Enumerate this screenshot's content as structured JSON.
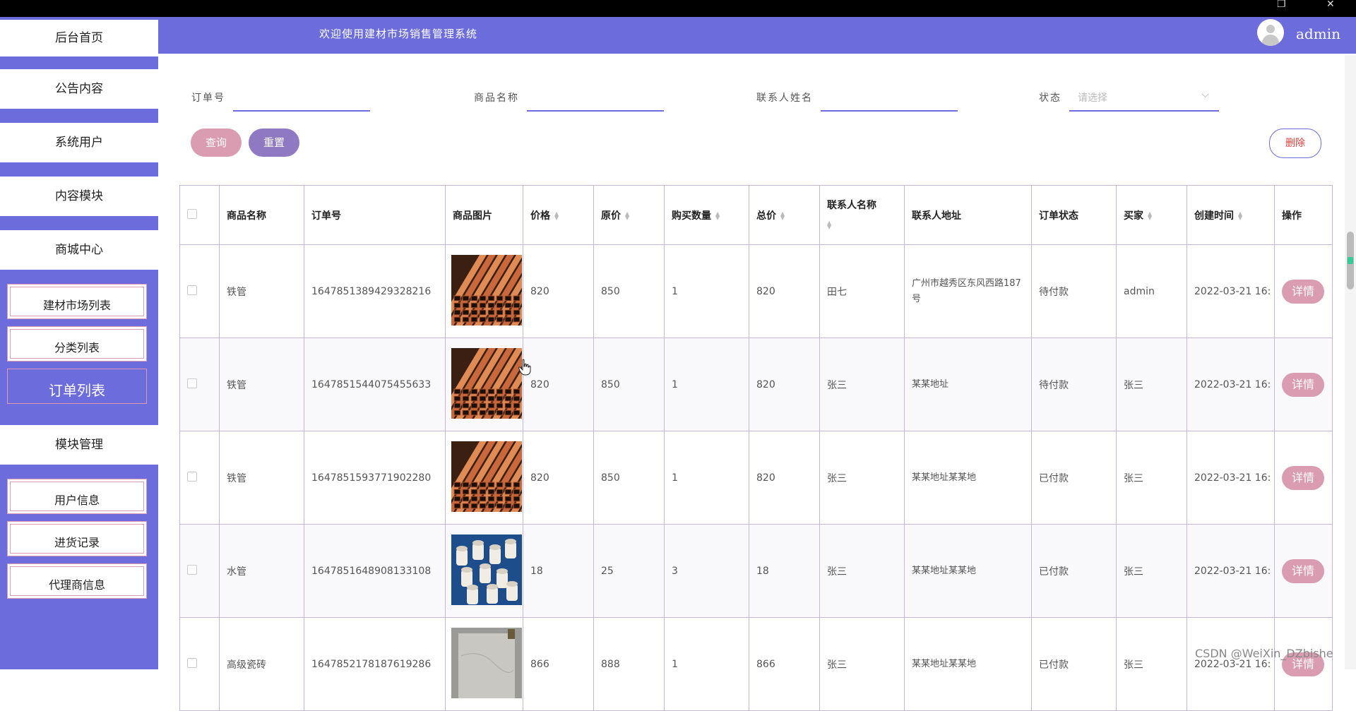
{
  "header": {
    "welcome": "欢迎使用建材市场销售管理系统",
    "username": "admin"
  },
  "sidebar": {
    "home": "后台首页",
    "groups": [
      {
        "label": "公告内容"
      },
      {
        "label": "系统用户"
      },
      {
        "label": "内容模块"
      },
      {
        "label": "商城中心",
        "items": [
          "建材市场列表",
          "分类列表",
          "订单列表"
        ],
        "active": "订单列表"
      },
      {
        "label": "模块管理",
        "items": [
          "用户信息",
          "进货记录",
          "代理商信息"
        ]
      }
    ]
  },
  "search": {
    "order_no_label": "订单号",
    "product_name_label": "商品名称",
    "contact_name_label": "联系人姓名",
    "status_label": "状态",
    "status_placeholder": "请选择",
    "query_button": "查询",
    "reset_button": "重置",
    "delete_button": "删除"
  },
  "table": {
    "headers": [
      "商品名称",
      "订单号",
      "商品图片",
      "价格",
      "原价",
      "购买数量",
      "总价",
      "联系人名称",
      "联系人地址",
      "订单状态",
      "买家",
      "创建时间",
      "操作"
    ],
    "detail_label": "详情",
    "rows": [
      {
        "name": "铁管",
        "order_no": "1647851389429328216",
        "image": "copper-pipes",
        "price": "820",
        "orig_price": "850",
        "qty": "1",
        "total": "820",
        "contact": "田七",
        "address": "广州市越秀区东风西路187号",
        "status": "待付款",
        "buyer": "admin",
        "created": "2022-03-21 16:"
      },
      {
        "name": "铁管",
        "order_no": "1647851544075455633",
        "image": "copper-pipes",
        "price": "820",
        "orig_price": "850",
        "qty": "1",
        "total": "820",
        "contact": "张三",
        "address": "某某地址",
        "status": "待付款",
        "buyer": "张三",
        "created": "2022-03-21 16:"
      },
      {
        "name": "铁管",
        "order_no": "1647851593771902280",
        "image": "copper-pipes",
        "price": "820",
        "orig_price": "850",
        "qty": "1",
        "total": "820",
        "contact": "张三",
        "address": "某某地址某某地",
        "status": "已付款",
        "buyer": "张三",
        "created": "2022-03-21 16:"
      },
      {
        "name": "水管",
        "order_no": "1647851648908133108",
        "image": "white-pipe-fittings",
        "price": "18",
        "orig_price": "25",
        "qty": "3",
        "total": "18",
        "contact": "张三",
        "address": "某某地址某某地",
        "status": "已付款",
        "buyer": "张三",
        "created": "2022-03-21 16:"
      },
      {
        "name": "高级瓷砖",
        "order_no": "1647852178187619286",
        "image": "marble-tile",
        "price": "866",
        "orig_price": "888",
        "qty": "1",
        "total": "866",
        "contact": "张三",
        "address": "某某地址某某地",
        "status": "已付款",
        "buyer": "张三",
        "created": "2022-03-21 16:"
      }
    ]
  },
  "watermark": "CSDN @WeiXin_DZbishe",
  "colors": {
    "primary": "#6c6cdc",
    "pink": "#d99cb0",
    "purple": "#8e79c2",
    "danger": "#e03c3c"
  }
}
